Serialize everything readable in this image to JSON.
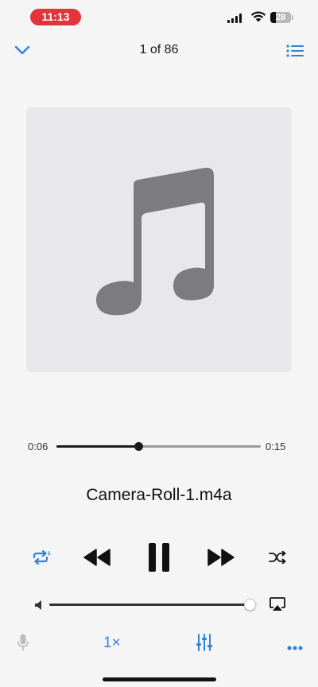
{
  "status": {
    "time": "11:13",
    "battery": "28",
    "battery_level": 0.28,
    "corner_text": ""
  },
  "header": {
    "counter": "1 of 86"
  },
  "player": {
    "elapsed": "0:06",
    "remaining": "0:15",
    "progress": 0.4,
    "title": "Camera-Roll-1.m4a",
    "volume": 0.98,
    "speed": "1×"
  },
  "colors": {
    "accent": "#2f84d8",
    "status_pill": "#e1353b",
    "artwork_bg": "#e8e8ea",
    "note": "#7c7b80"
  },
  "icons": [
    "chevron-down-icon",
    "list-icon",
    "music-note-icon",
    "repeat-one-icon",
    "rewind-icon",
    "pause-icon",
    "fast-forward-icon",
    "shuffle-icon",
    "speaker-icon",
    "airplay-icon",
    "microphone-icon",
    "equalizer-icon",
    "more-icon"
  ]
}
